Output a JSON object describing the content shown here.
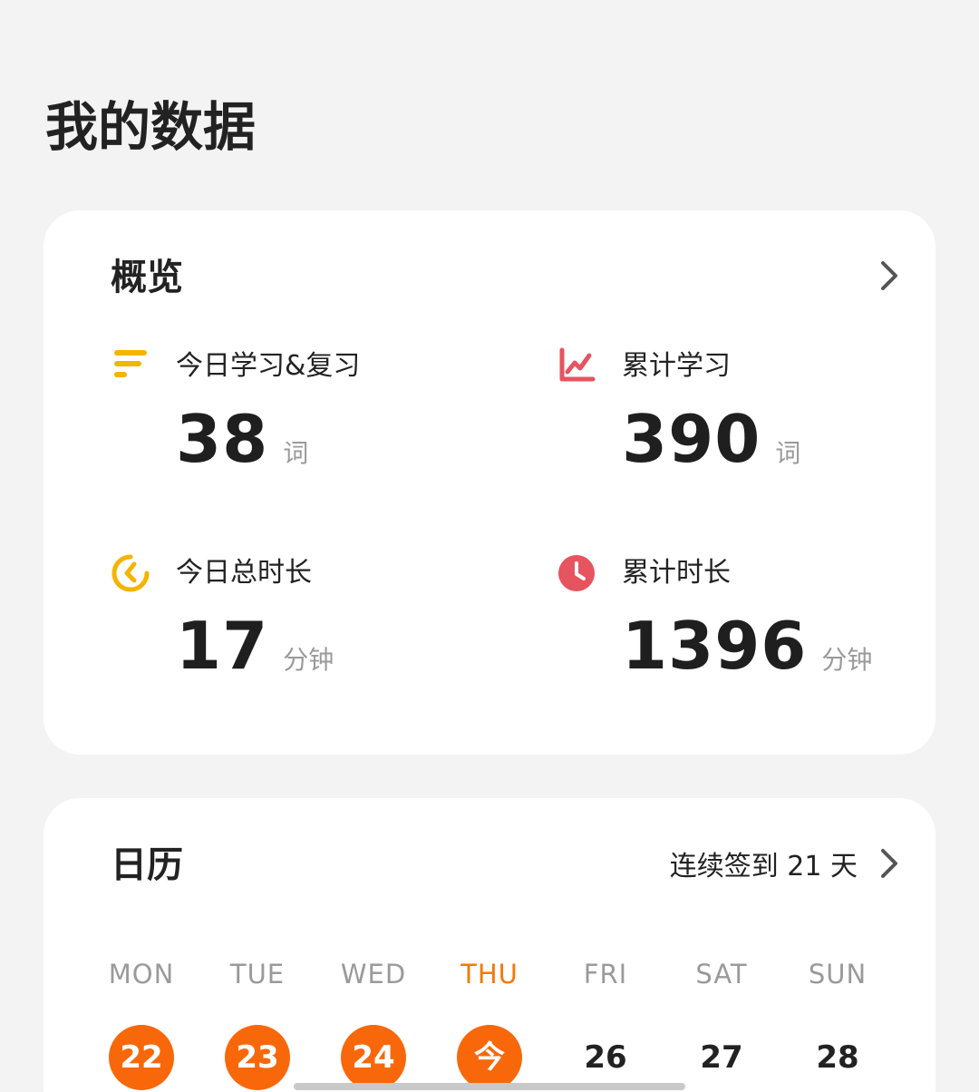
{
  "page_title": "我的数据",
  "overview": {
    "title": "概览",
    "stats": [
      {
        "label": "今日学习&复习",
        "value": "38",
        "unit": "词",
        "icon": "bars-icon",
        "color": "#f5b400"
      },
      {
        "label": "累计学习",
        "value": "390",
        "unit": "词",
        "icon": "line-chart-icon",
        "color": "#e5545f"
      },
      {
        "label": "今日总时长",
        "value": "17",
        "unit": "分钟",
        "icon": "timer-icon",
        "color": "#f5b400"
      },
      {
        "label": "累计时长",
        "value": "1396",
        "unit": "分钟",
        "icon": "clock-icon",
        "color": "#e5545f"
      }
    ]
  },
  "calendar": {
    "title": "日历",
    "streak": "连续签到 21 天",
    "days": [
      {
        "dow": "MON",
        "date": "22",
        "checked": true
      },
      {
        "dow": "TUE",
        "date": "23",
        "checked": true
      },
      {
        "dow": "WED",
        "date": "24",
        "checked": true
      },
      {
        "dow": "THU",
        "date": "今",
        "checked": true,
        "today": true
      },
      {
        "dow": "FRI",
        "date": "26",
        "checked": false
      },
      {
        "dow": "SAT",
        "date": "27",
        "checked": false
      },
      {
        "dow": "SUN",
        "date": "28",
        "checked": false
      }
    ],
    "accent_color": "#f8680a"
  }
}
